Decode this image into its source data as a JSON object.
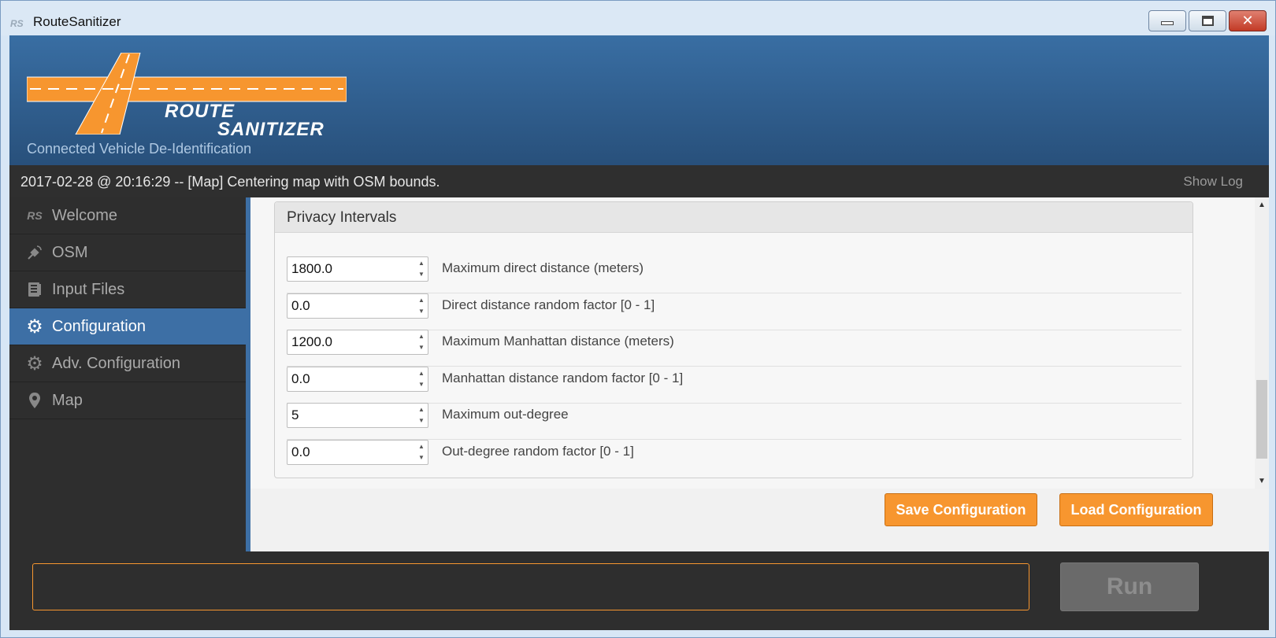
{
  "window": {
    "app_icon_text": "RS",
    "title": "RouteSanitizer",
    "close_glyph": "✕"
  },
  "header": {
    "logo_line1": "ROUTE",
    "logo_line2": "SANITIZER",
    "subtitle": "Connected Vehicle De-Identification"
  },
  "status": {
    "message": "2017-02-28 @ 20:16:29 -- [Map] Centering map with OSM bounds.",
    "show_log_label": "Show Log"
  },
  "sidebar": {
    "items": [
      {
        "label": "Welcome",
        "icon": "rs-logo-icon",
        "glyph": "RS",
        "active": false
      },
      {
        "label": "OSM",
        "icon": "satellite-icon",
        "glyph": "🛰",
        "active": false
      },
      {
        "label": "Input Files",
        "icon": "files-icon",
        "glyph": "▤",
        "active": false
      },
      {
        "label": "Configuration",
        "icon": "gear-icon",
        "glyph": "⚙",
        "active": true
      },
      {
        "label": "Adv. Configuration",
        "icon": "gear-icon",
        "glyph": "⚙",
        "active": false
      },
      {
        "label": "Map",
        "icon": "map-pin-icon",
        "glyph": "⚲",
        "active": false
      }
    ]
  },
  "panel": {
    "title": "Privacy Intervals",
    "fields": [
      {
        "value": "1800.0",
        "label": "Maximum direct distance (meters)"
      },
      {
        "value": "0.0",
        "label": "Direct distance random factor [0 - 1]"
      },
      {
        "value": "1200.0",
        "label": "Maximum Manhattan distance (meters)"
      },
      {
        "value": "0.0",
        "label": "Manhattan distance random factor [0 - 1]"
      },
      {
        "value": "5",
        "label": "Maximum out-degree"
      },
      {
        "value": "0.0",
        "label": "Out-degree random factor [0 - 1]"
      }
    ]
  },
  "actions": {
    "save_label": "Save Configuration",
    "load_label": "Load Configuration"
  },
  "bottom": {
    "command_value": "",
    "run_label": "Run"
  },
  "colors": {
    "accent_orange": "#f7962f",
    "header_blue": "#396ea3",
    "active_blue": "#3d6fa5",
    "dark_bg": "#2e2e2e"
  }
}
